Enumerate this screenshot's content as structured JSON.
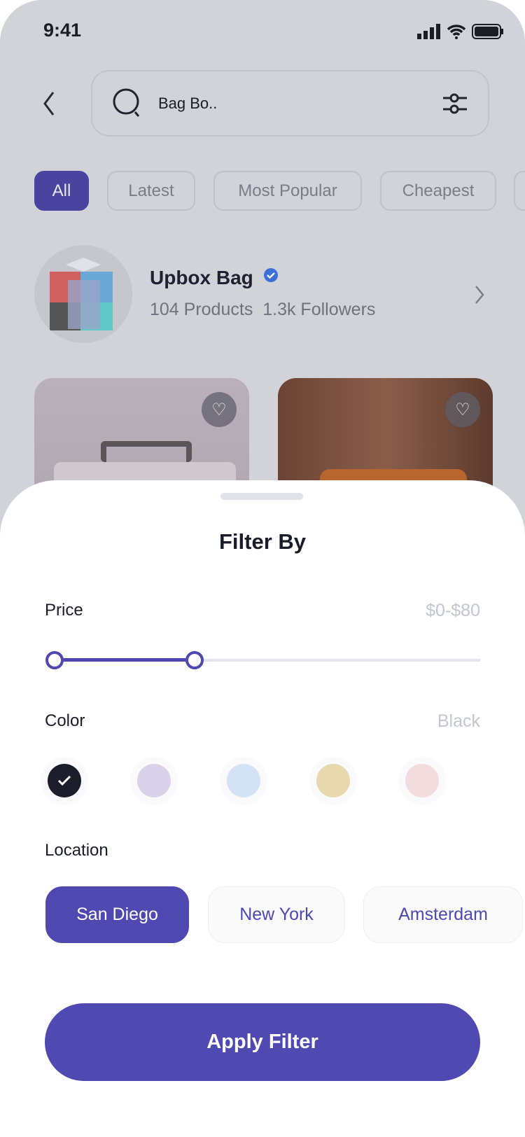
{
  "status_bar": {
    "time": "9:41"
  },
  "search": {
    "value": "Bag Bo.."
  },
  "tabs": [
    {
      "label": "All",
      "active": true
    },
    {
      "label": "Latest"
    },
    {
      "label": "Most Popular"
    },
    {
      "label": "Cheapest"
    }
  ],
  "store": {
    "name": "Upbox Bag",
    "products": "104 Products",
    "followers": "1.3k Followers",
    "verified": true
  },
  "filter": {
    "title": "Filter By",
    "price": {
      "label": "Price",
      "value": "$0-$80",
      "range": [
        0,
        80
      ]
    },
    "color": {
      "label": "Color",
      "value": "Black",
      "swatches": [
        "#1c1d2b",
        "#d9d2ea",
        "#d3e3f5",
        "#e8d8ae",
        "#f3dcdd"
      ],
      "selected": 0
    },
    "location": {
      "label": "Location",
      "options": [
        "San Diego",
        "New York",
        "Amsterdam"
      ],
      "selected": 0
    },
    "apply_label": "Apply Filter"
  },
  "colors": {
    "accent": "#4e48b0"
  }
}
